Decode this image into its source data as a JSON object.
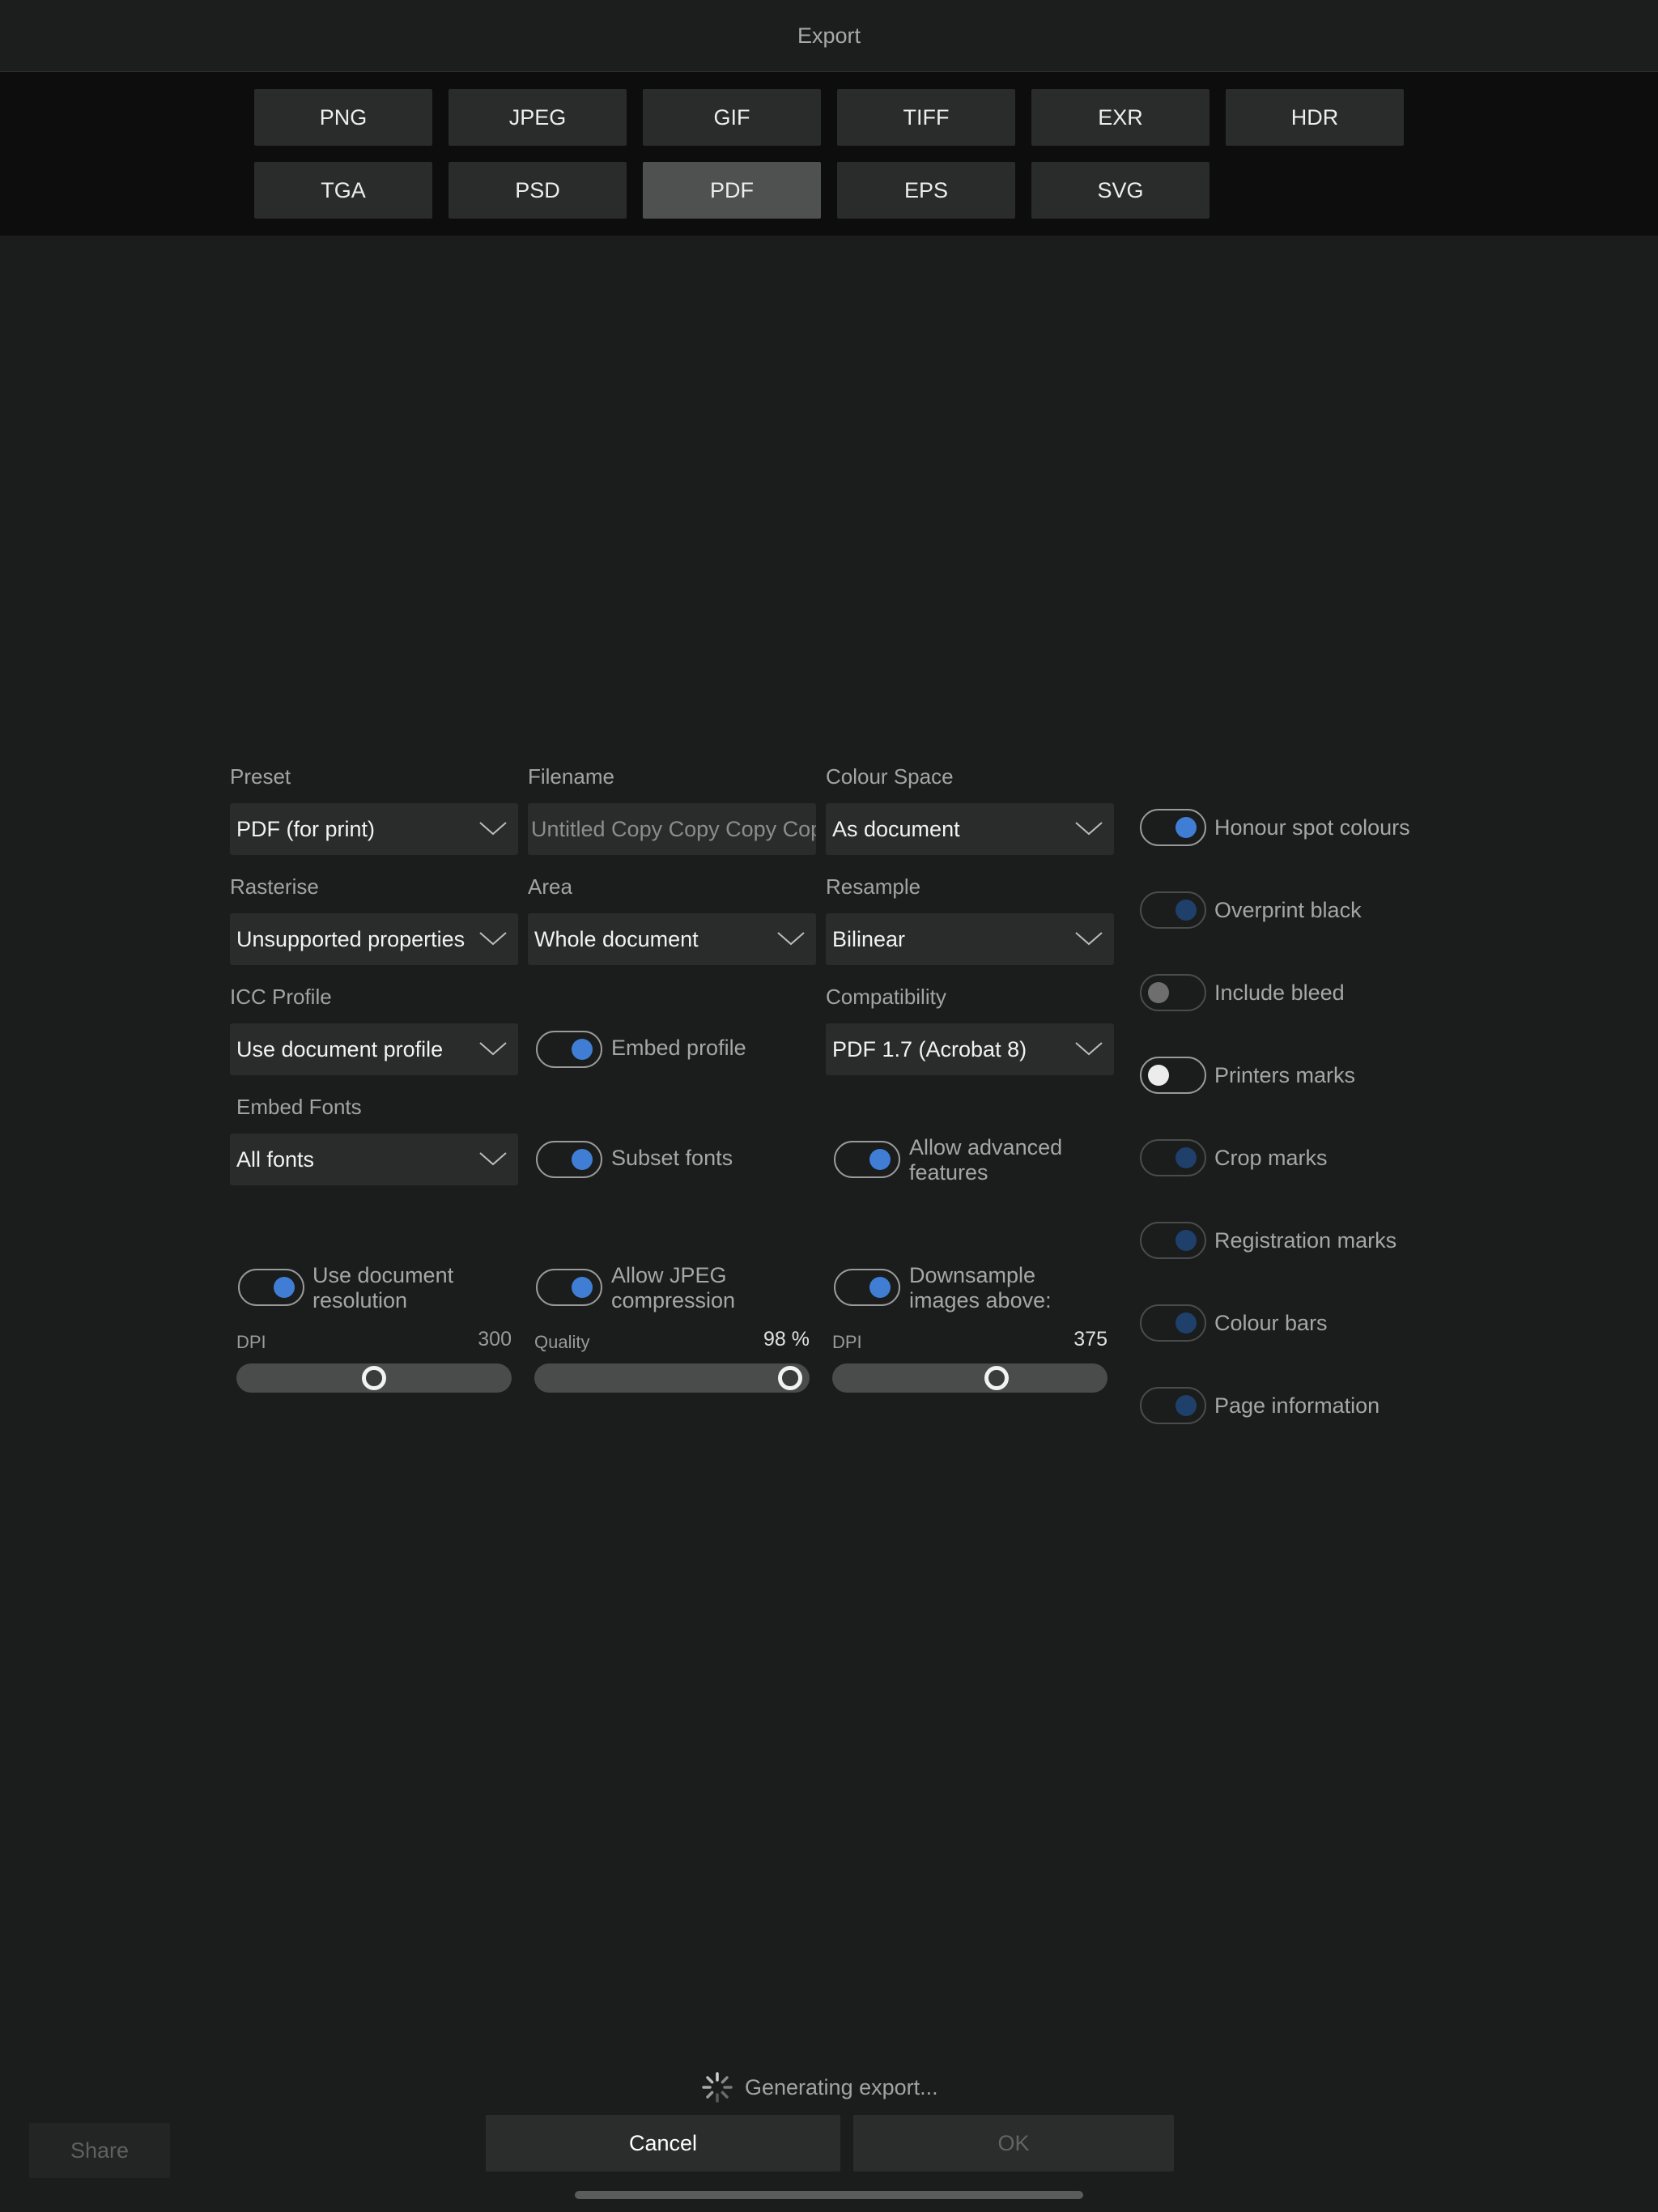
{
  "title": "Export",
  "formats": [
    "PNG",
    "JPEG",
    "GIF",
    "TIFF",
    "EXR",
    "HDR",
    "TGA",
    "PSD",
    "PDF",
    "EPS",
    "SVG"
  ],
  "selected_format": "PDF",
  "labels": {
    "preset": "Preset",
    "filename": "Filename",
    "colour_space": "Colour Space",
    "rasterise": "Rasterise",
    "area": "Area",
    "resample": "Resample",
    "icc_profile": "ICC Profile",
    "compatibility": "Compatibility",
    "embed_fonts": "Embed Fonts"
  },
  "values": {
    "preset": "PDF (for print)",
    "filename": "Untitled Copy Copy Copy Copy",
    "colour_space": "As document",
    "rasterise": "Unsupported properties",
    "area": "Whole document",
    "resample": "Bilinear",
    "icc_profile": "Use document profile",
    "compatibility": "PDF 1.7 (Acrobat 8)",
    "embed_fonts": "All fonts"
  },
  "toggles": {
    "embed_profile": "Embed profile",
    "subset_fonts": "Subset fonts",
    "allow_advanced_line1": "Allow advanced",
    "allow_advanced_line2": "features",
    "use_doc_res_line1": "Use document",
    "use_doc_res_line2": "resolution",
    "allow_jpeg_line1": "Allow JPEG",
    "allow_jpeg_line2": "compression",
    "downsample_line1": "Downsample",
    "downsample_line2": "images above:"
  },
  "right_options": {
    "honour_spot": "Honour spot colours",
    "overprint_black": "Overprint black",
    "include_bleed": "Include bleed",
    "printers_marks": "Printers marks",
    "crop_marks": "Crop marks",
    "registration_marks": "Registration marks",
    "colour_bars": "Colour bars",
    "page_information": "Page information"
  },
  "sliders": {
    "dpi_label": "DPI",
    "dpi_value": "300",
    "dpi_fraction": 0.5,
    "quality_label": "Quality",
    "quality_value": "98 %",
    "quality_fraction": 0.98,
    "downsample_label": "DPI",
    "downsample_value": "375",
    "downsample_fraction": 0.61
  },
  "status_text": "Generating export...",
  "buttons": {
    "share": "Share",
    "cancel": "Cancel",
    "ok": "OK"
  },
  "colors": {
    "accent": "#3f7ed4",
    "background": "#1b1c1c",
    "panel": "#2a2b2b"
  }
}
